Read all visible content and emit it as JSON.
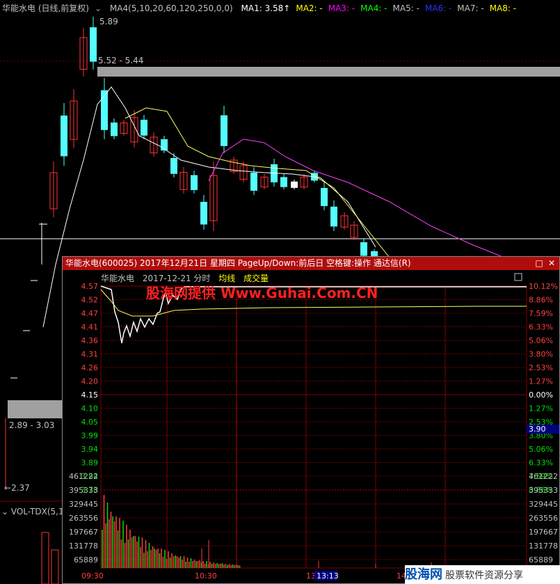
{
  "main": {
    "title": "华能水电 (日线,前复权)",
    "ma_params": "MA4(5,10,20,60,120,250,0,0)",
    "ma": [
      {
        "label": "MA1: 3.58↑",
        "color": "#ffffff"
      },
      {
        "label": "MA2: -",
        "color": "#ffff00"
      },
      {
        "label": "MA3: -",
        "color": "#ff00ff"
      },
      {
        "label": "MA4: -",
        "color": "#00ff00"
      },
      {
        "label": "MA5: -",
        "color": "#c0c0c0"
      },
      {
        "label": "MA6: -",
        "color": "#3030ff"
      },
      {
        "label": "MA7: -",
        "color": "#c0c0c0"
      },
      {
        "label": "MA8: -",
        "color": "#ffff00"
      }
    ],
    "annot_high": "5.89",
    "annot_range1": "5.52 - 5.44",
    "annot_range2": "2.89 - 3.03",
    "annot_low": "2.37",
    "vol_label": "VOL-TDX(5,1"
  },
  "popup": {
    "title": "华能水电(600025) 2017年12月21日 星期四 PageUp/Down:前后日 空格键:操作 通达信(R)",
    "sub_name": "华能水电",
    "sub_date": "2017-12-21 分时",
    "sub_avg": "均线",
    "sub_vol": "成交量",
    "watermark": "股海网提供 Www.Guhai.Com.CN",
    "prices": [
      "4.57",
      "4.52",
      "4.47",
      "4.41",
      "4.36",
      "4.31",
      "4.26",
      "4.20",
      "4.15",
      "4.10",
      "4.05",
      "3.99",
      "3.94",
      "3.89",
      "3.84",
      "3.78"
    ],
    "pcts": [
      "10.12%",
      "8.86%",
      "7.59%",
      "6.33%",
      "5.06%",
      "3.80%",
      "2.53%",
      "1.27%",
      "0.00%",
      "1.27%",
      "2.53%",
      "3.80%",
      "5.06%",
      "6.33%",
      "7.59%",
      "8.86%"
    ],
    "current_price": "3.90",
    "vols": [
      "461222",
      "395333",
      "329445",
      "263556",
      "197667",
      "131778",
      "65889"
    ],
    "time_labels": [
      "09:30",
      "10:30",
      "13:00",
      "14"
    ],
    "cursor_time": "13:13"
  },
  "brand": {
    "logo": "股海网",
    "tag": "股票软件资源分享",
    "url": "www.Guhai.com.cn"
  }
}
